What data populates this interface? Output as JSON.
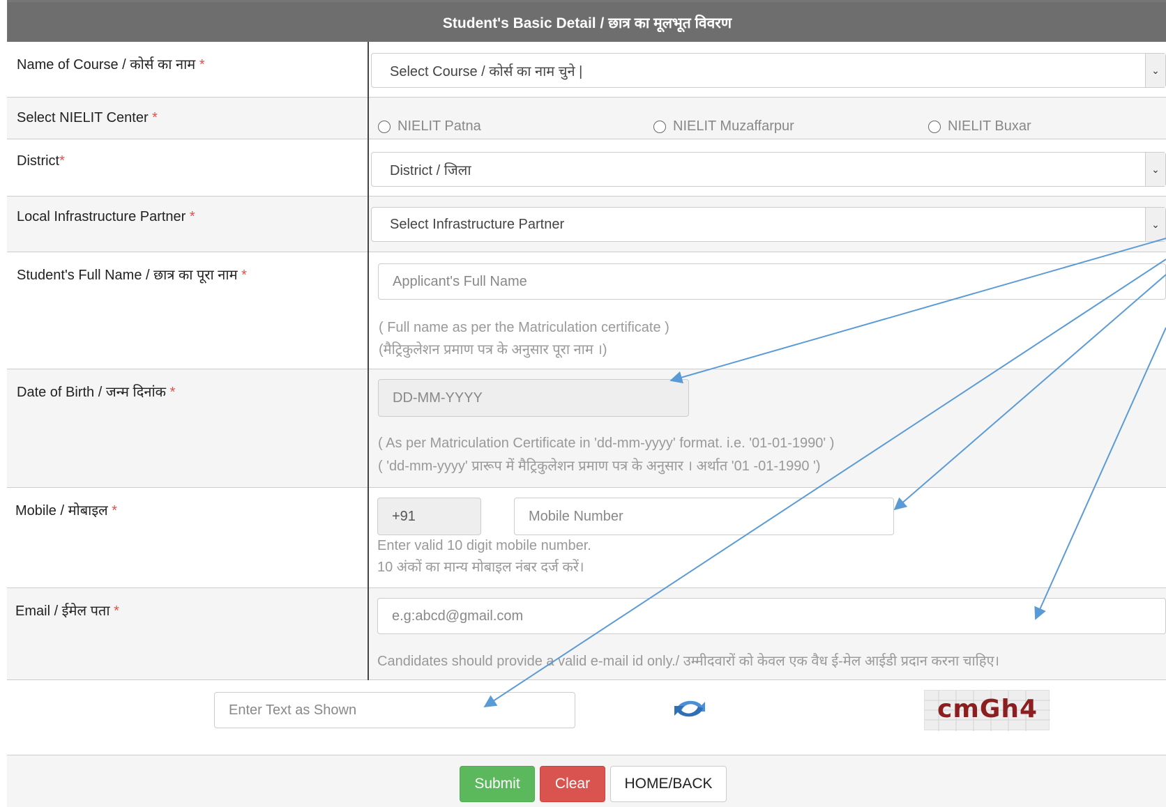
{
  "header": {
    "title": "Student's Basic Detail / छात्र का मूलभूत विवरण"
  },
  "required_mark": "*",
  "course": {
    "label": "Name of Course / कोर्स का नाम",
    "value": "Select Course / कोर्स का नाम चुने |"
  },
  "center": {
    "label": "Select NIELIT Center",
    "options": [
      "NIELIT Patna",
      "NIELIT Muzaffarpur",
      "NIELIT Buxar"
    ]
  },
  "district": {
    "label": "District",
    "value": "District / जिला"
  },
  "partner": {
    "label": "Local Infrastructure Partner",
    "value": "Select Infrastructure Partner"
  },
  "full_name": {
    "label": "Student's Full Name / छात्र का पूरा नाम",
    "placeholder": "Applicant's Full Name",
    "help_en": "( Full name as per the Matriculation certificate )",
    "help_hi": "(मैट्रिकुलेशन प्रमाण पत्र के अनुसार पूरा नाम ।)"
  },
  "dob": {
    "label": "Date of Birth / जन्म दिनांक",
    "placeholder": "DD-MM-YYYY",
    "help_en": "( As per Matriculation Certificate in 'dd-mm-yyyy' format. i.e. '01-01-1990' )",
    "help_hi": "( 'dd-mm-yyyy' प्रारूप में मैट्रिकुलेशन प्रमाण पत्र के अनुसार । अर्थात '01 -01-1990 ')"
  },
  "mobile": {
    "label": "Mobile / मोबाइल",
    "prefix": "+91",
    "placeholder": "Mobile Number",
    "help_en": "Enter valid 10 digit mobile number.",
    "help_hi": "10 अंकों का मान्य मोबाइल नंबर दर्ज करें।"
  },
  "email": {
    "label": "Email / ईमेल पता",
    "placeholder": "e.g:abcd@gmail.com",
    "help": "Candidates should provide a valid e-mail id only./ उम्मीदवारों को केवल एक वैध ई-मेल आईडी प्रदान करना चाहिए।"
  },
  "captcha": {
    "placeholder": "Enter Text as Shown",
    "code": "cmGh4",
    "refresh_icon": "refresh-icon"
  },
  "buttons": {
    "submit": "Submit",
    "clear": "Clear",
    "home": "HOME/BACK"
  },
  "colors": {
    "header": "#6e6e6e",
    "submit": "#5cb85c",
    "clear": "#d9534f",
    "annotation_arrow": "#5b9bd5",
    "required": "#d9534f"
  }
}
